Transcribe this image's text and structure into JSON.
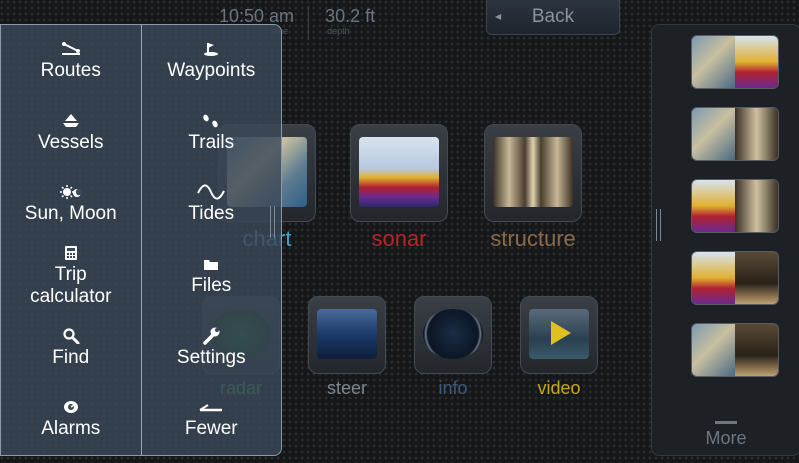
{
  "status": {
    "time_value": "10:50 am",
    "time_label": "time",
    "depth_value": "30.2 ft",
    "depth_label": "depth"
  },
  "back_label": "Back",
  "apps": {
    "chart": "chart",
    "sonar": "sonar",
    "structure": "structure",
    "radar": "radar",
    "steer": "steer",
    "info": "info",
    "video": "video"
  },
  "app_colors": {
    "chart": "#4a9fd0",
    "sonar": "#b3262a",
    "structure": "#8a6a4a",
    "radar": "#3fae4a",
    "steer": "#7c8792",
    "info": "#3d5a78",
    "video": "#c9a81e"
  },
  "menu": {
    "left": [
      {
        "label": "Routes",
        "icon": "routes-icon"
      },
      {
        "label": "Vessels",
        "icon": "vessels-icon"
      },
      {
        "label": "Sun, Moon",
        "icon": "sun-moon-icon"
      },
      {
        "label": "Trip\ncalculator",
        "icon": "trip-calculator-icon"
      },
      {
        "label": "Find",
        "icon": "find-icon"
      },
      {
        "label": "Alarms",
        "icon": "alarms-icon"
      }
    ],
    "right": [
      {
        "label": "Waypoints",
        "icon": "waypoints-icon"
      },
      {
        "label": "Trails",
        "icon": "trails-icon"
      },
      {
        "label": "Tides",
        "icon": "tides-icon"
      },
      {
        "label": "Files",
        "icon": "files-icon"
      },
      {
        "label": "Settings",
        "icon": "settings-icon"
      },
      {
        "label": "Fewer",
        "icon": "fewer-icon"
      }
    ]
  },
  "more_label": "More"
}
